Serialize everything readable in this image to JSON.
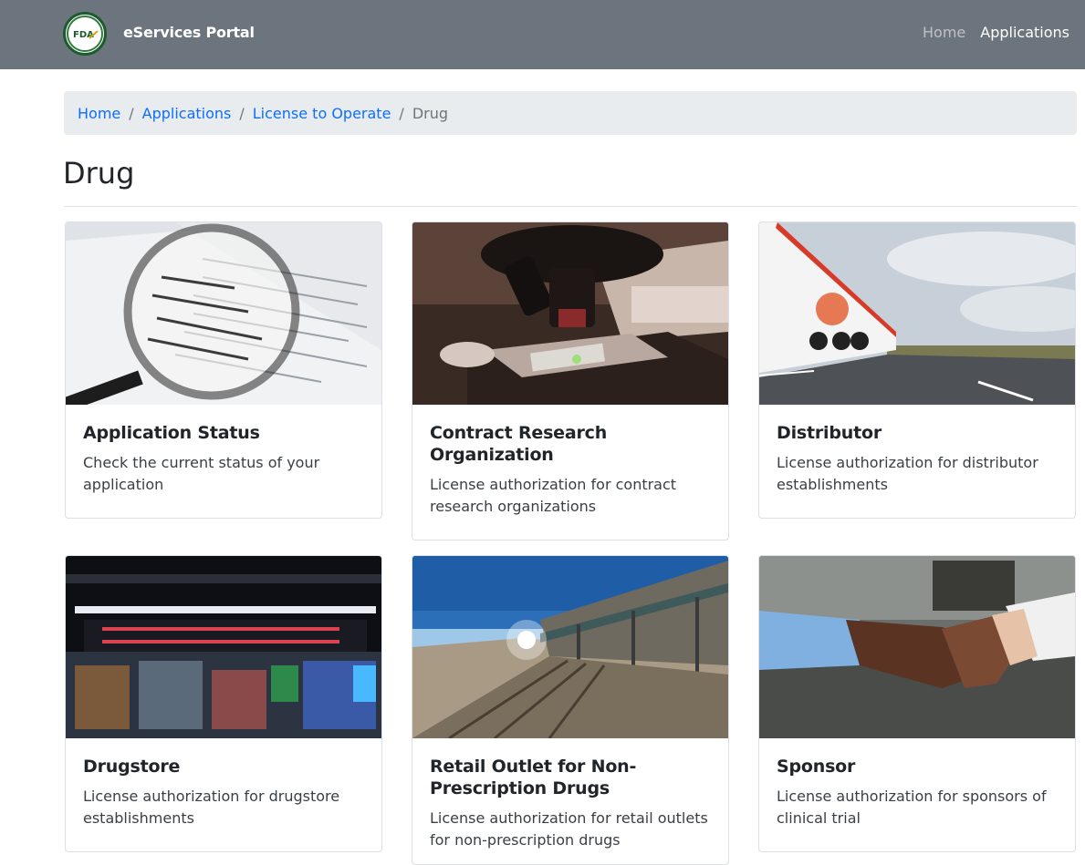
{
  "navbar": {
    "logo_text": "FDA",
    "brand": "eServices Portal",
    "links": [
      {
        "label": "Home"
      },
      {
        "label": "Applications"
      }
    ]
  },
  "breadcrumb": {
    "items": [
      "Home",
      "Applications",
      "License to Operate"
    ],
    "separator": "/",
    "current": "Drug"
  },
  "page": {
    "title": "Drug"
  },
  "cards": [
    {
      "title": "Application Status",
      "text": "Check the current status of your application",
      "image": "magnifying-glass-document"
    },
    {
      "title": "Contract Research Organization",
      "text": "License authorization for contract research organizations",
      "image": "microscope"
    },
    {
      "title": "Distributor",
      "text": "License authorization for distributor establishments",
      "image": "truck-on-road"
    },
    {
      "title": "Drugstore",
      "text": "License authorization for drugstore establishments",
      "image": "prescriptions-storefront"
    },
    {
      "title": "Retail Outlet for Non-Prescription Drugs",
      "text": "License authorization for retail outlets for non-prescription drugs",
      "image": "general-store"
    },
    {
      "title": "Sponsor",
      "text": "License authorization for sponsors of clinical trial",
      "image": "handshake"
    }
  ],
  "colors": {
    "navbar_bg": "#6c757d",
    "link": "#0d6efd",
    "breadcrumb_bg": "#e9ecef",
    "logo_ring": "#1f5a2e"
  }
}
